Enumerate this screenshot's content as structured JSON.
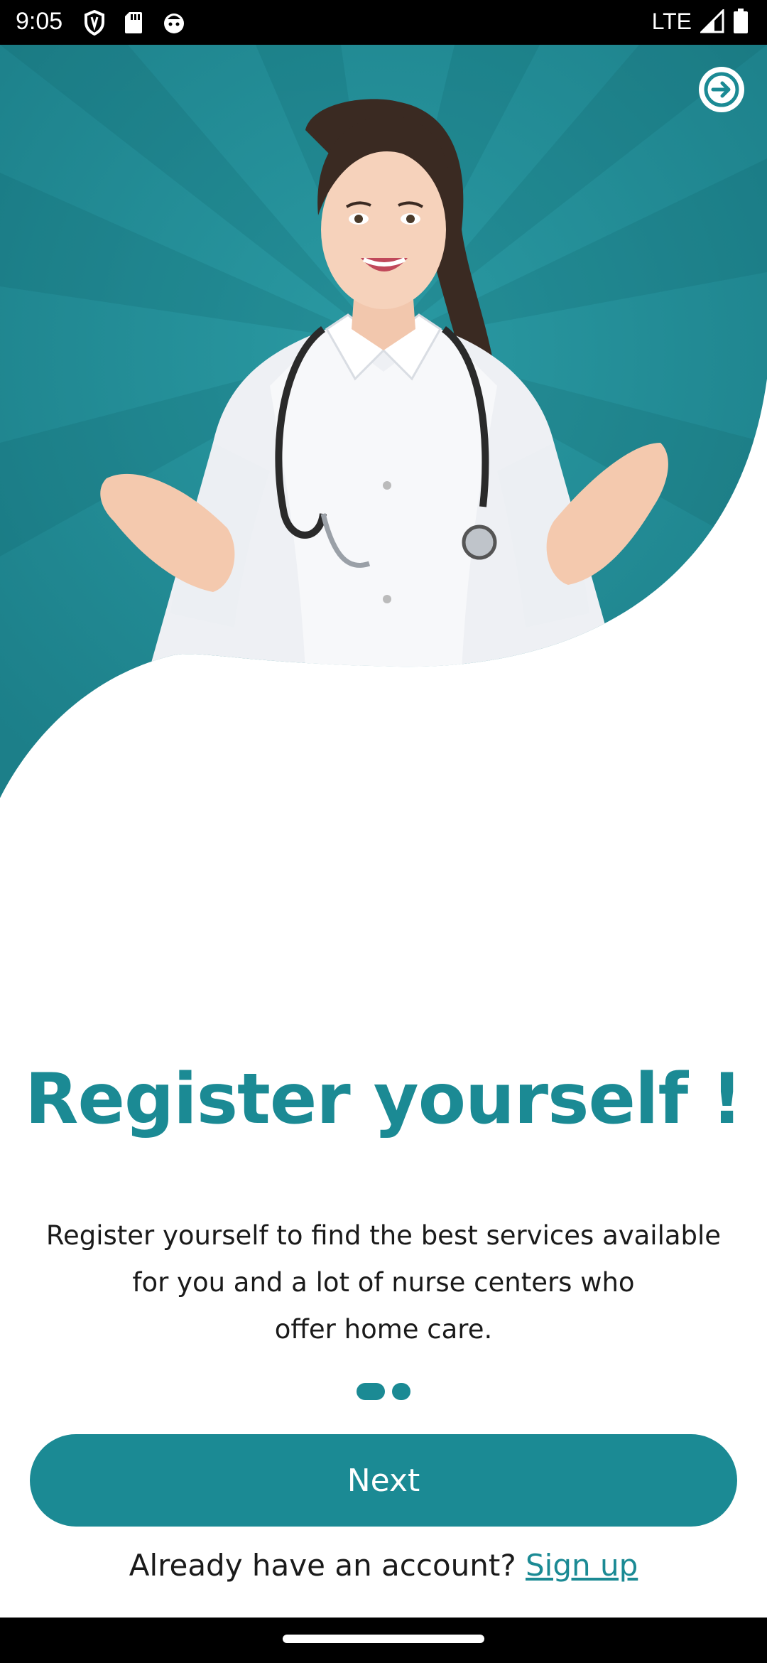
{
  "status_bar": {
    "time": "9:05",
    "network": "LTE",
    "icons": [
      "shield-icon",
      "sd-card-icon",
      "face-icon",
      "signal-icon",
      "battery-icon"
    ]
  },
  "hero": {
    "image": "smiling-nurse-with-stethoscope",
    "background_color": "#1f8c96"
  },
  "skip": {
    "icon": "arrow-right-icon"
  },
  "onboarding": {
    "title": "Register yourself !",
    "description_lines": [
      "Register yourself to find the best services available",
      "for you and a lot of nurse centers who",
      "offer home care."
    ],
    "page_count": 2,
    "current_page": 1
  },
  "actions": {
    "next_label": "Next",
    "account_prompt": "Already have an account?",
    "signup_label": "Sign up"
  },
  "colors": {
    "accent": "#1b8a94",
    "text": "#1a1a1a"
  }
}
